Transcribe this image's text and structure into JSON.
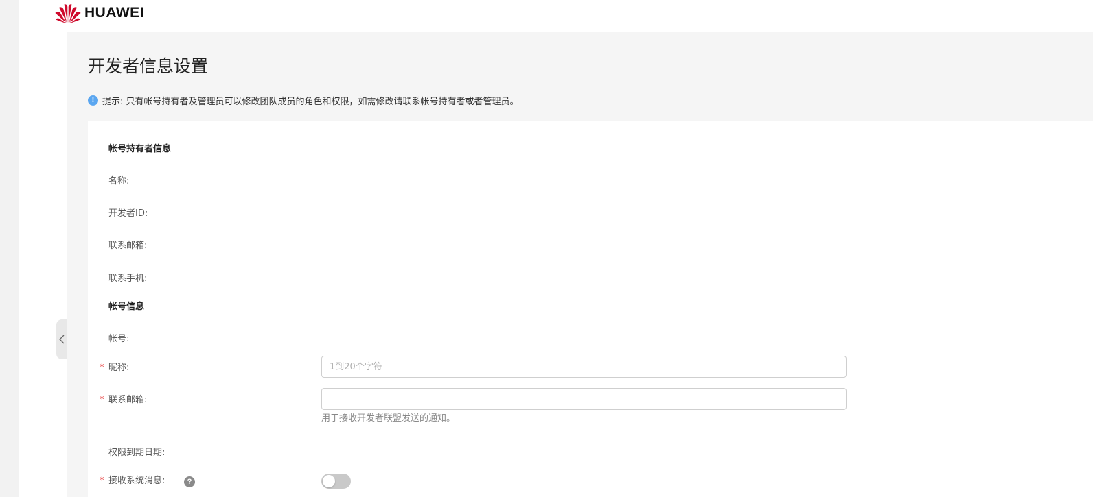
{
  "header": {
    "brand": "HUAWEI",
    "brand_color": "#cf0a2c"
  },
  "page": {
    "title": "开发者信息设置"
  },
  "notice": {
    "icon": "info-icon",
    "text": "提示: 只有帐号持有者及管理员可以修改团队成员的角色和权限，如需修改请联系帐号持有者或者管理员。"
  },
  "holder_section": {
    "title": "帐号持有者信息",
    "fields": [
      {
        "label": "名称:",
        "value": ""
      },
      {
        "label": "开发者ID:",
        "value": ""
      },
      {
        "label": "联系邮箱:",
        "value": ""
      },
      {
        "label": "联系手机:",
        "value": ""
      }
    ]
  },
  "account_section": {
    "title": "帐号信息",
    "account_label": "帐号:",
    "nickname": {
      "required": "*",
      "label": "昵称:",
      "value": "",
      "placeholder": "1到20个字符"
    },
    "email": {
      "required": "*",
      "label": "联系邮箱:",
      "value": "",
      "placeholder": "",
      "hint": "用于接收开发者联盟发送的通知。"
    },
    "expiry_label": "权限到期日期:",
    "system_messages": {
      "required": "*",
      "label": "接收系统消息:",
      "help": "?",
      "enabled": false
    }
  },
  "sidebar": {
    "collapse_icon": "chevron-left-icon"
  }
}
